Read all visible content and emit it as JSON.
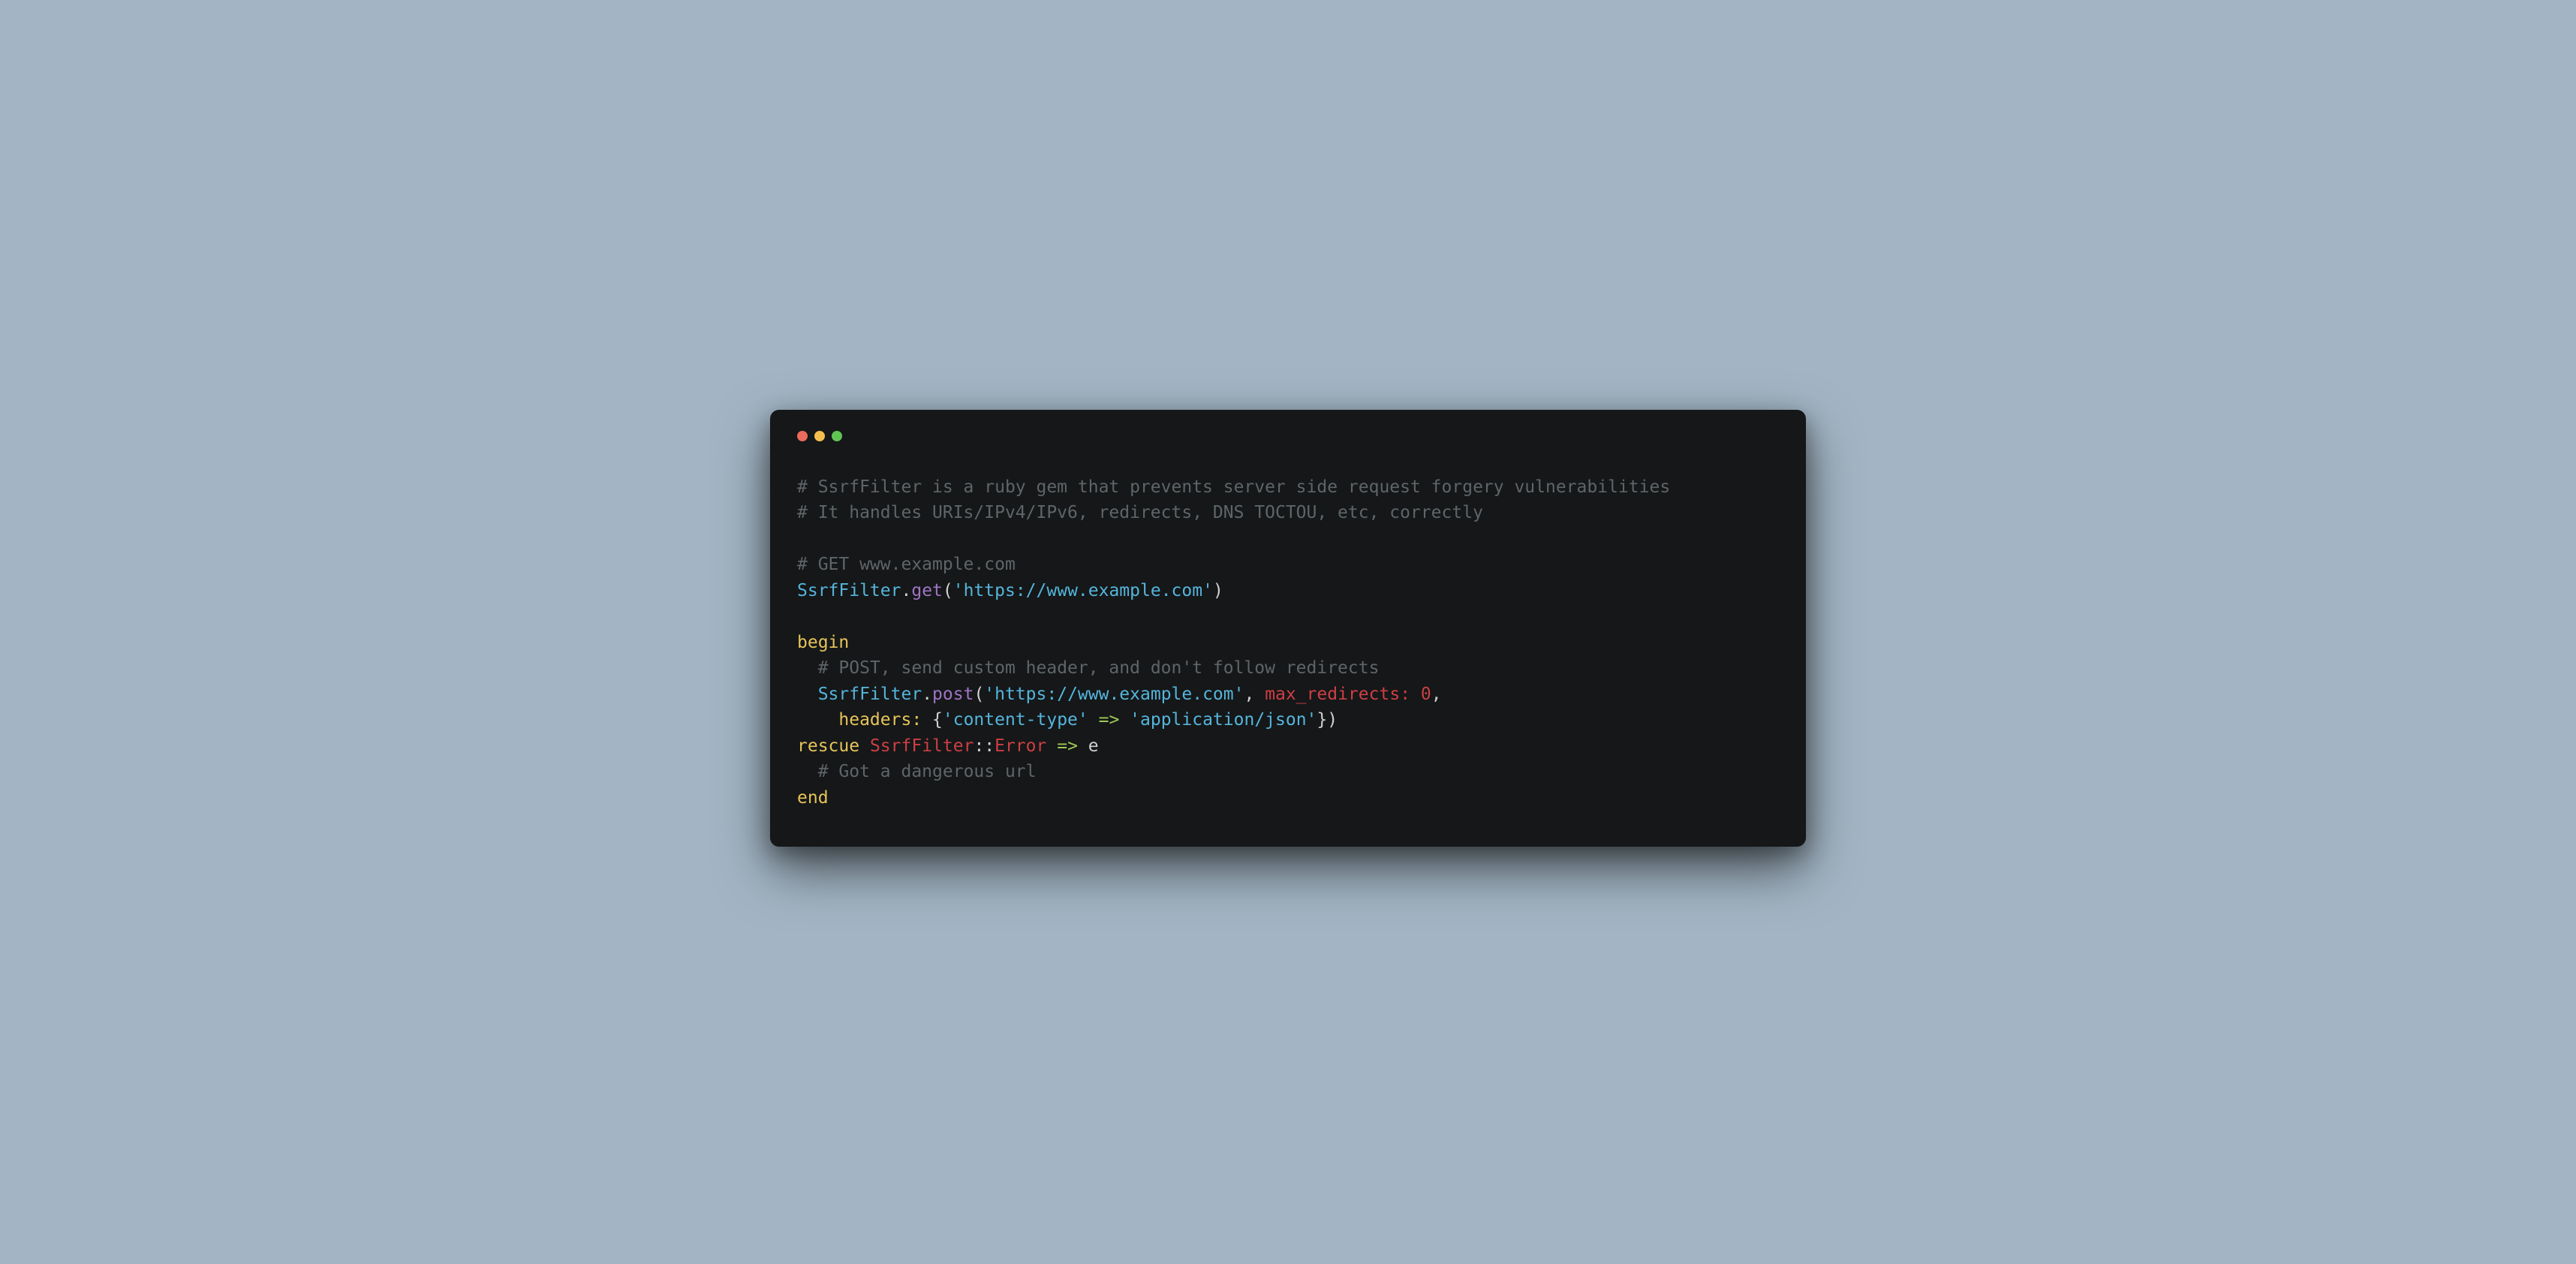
{
  "code": {
    "l1": "# SsrfFilter is a ruby gem that prevents server side request forgery vulnerabilities",
    "l2": "# It handles URIs/IPv4/IPv6, redirects, DNS TOCTOU, etc, correctly",
    "l3": "",
    "l4": "# GET www.example.com",
    "l5_class": "SsrfFilter",
    "l5_dot": ".",
    "l5_method": "get",
    "l5_p1": "(",
    "l5_str": "'https://www.example.com'",
    "l5_p2": ")",
    "l6": "",
    "l7_kw": "begin",
    "l8_indent": "  ",
    "l8": "# POST, send custom header, and don't follow redirects",
    "l9_indent": "  ",
    "l9_class": "SsrfFilter",
    "l9_dot": ".",
    "l9_method": "post",
    "l9_p1": "(",
    "l9_str": "'https://www.example.com'",
    "l9_c1": ", ",
    "l9_sym": "max_redirects:",
    "l9_sp": " ",
    "l9_num": "0",
    "l9_c2": ",",
    "l10_indent": "    ",
    "l10_sym": "headers:",
    "l10_sp": " ",
    "l10_p1": "{",
    "l10_str1": "'content-type'",
    "l10_arrow": " => ",
    "l10_str2": "'application/json'",
    "l10_p2": "})",
    "l11_kw": "rescue",
    "l11_sp": " ",
    "l11_class": "SsrfFilter",
    "l11_scope": "::",
    "l11_err": "Error",
    "l11_arrow": " => ",
    "l11_var": "e",
    "l12_indent": "  ",
    "l12": "# Got a dangerous url",
    "l13_kw": "end"
  },
  "colors": {
    "bg": "#a3b5c4",
    "window": "#151718",
    "comment": "#5e6569",
    "keyword": "#e6c45a",
    "class": "#55b5db",
    "method": "#a074c4",
    "string": "#55b5db",
    "symbol": "#cd3f45",
    "number": "#cd3f45",
    "plain": "#cfd2d0",
    "arrow": "#9fca56"
  }
}
